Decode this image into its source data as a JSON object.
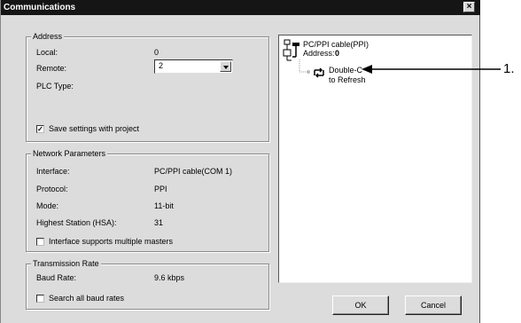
{
  "window": {
    "title": "Communications",
    "close_glyph": "×"
  },
  "address": {
    "group_label": "Address",
    "local_label": "Local:",
    "local_value": "0",
    "remote_label": "Remote:",
    "remote_value": "2",
    "plc_type_label": "PLC Type:",
    "save_settings_label": "Save settings with project",
    "save_settings_checked": true
  },
  "network": {
    "group_label": "Network Parameters",
    "rows": [
      {
        "label": "Interface:",
        "value": "PC/PPI cable(COM 1)"
      },
      {
        "label": "Protocol:",
        "value": "PPI"
      },
      {
        "label": "Mode:",
        "value": "11-bit"
      },
      {
        "label": "Highest Station (HSA):",
        "value": "31"
      }
    ],
    "multi_master_label": "Interface supports multiple masters",
    "multi_master_checked": false
  },
  "transmission": {
    "group_label": "Transmission Rate",
    "baud_label": "Baud Rate:",
    "baud_value": "9.6 kbps",
    "search_all_label": "Search all baud rates",
    "search_all_checked": false
  },
  "tree": {
    "cable_label": "PC/PPI cable(PPI)",
    "address_label": "Address:",
    "address_value": "0",
    "refresh_line1": "Double-C",
    "refresh_line2": "to Refresh"
  },
  "buttons": {
    "ok": "OK",
    "cancel": "Cancel"
  },
  "callout": {
    "label": "1."
  },
  "icons": [
    "close-icon",
    "cable-icon",
    "refresh-icon",
    "dropdown-arrow-icon",
    "checkmark-icon"
  ]
}
